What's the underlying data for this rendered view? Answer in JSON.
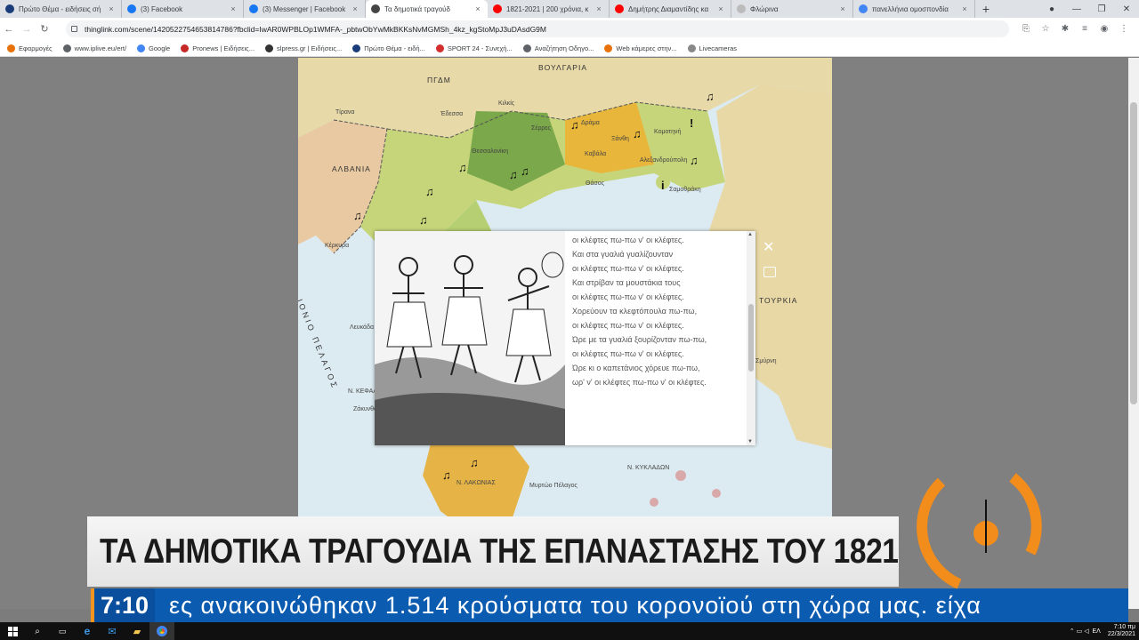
{
  "browser": {
    "tabs": [
      {
        "label": "Πρώτο Θέμα - ειδήσεις σή",
        "color": "#1a3c7a",
        "active": false
      },
      {
        "label": "(3) Facebook",
        "color": "#1877f2",
        "active": false
      },
      {
        "label": "(3) Messenger | Facebook",
        "color": "#1877f2",
        "active": false
      },
      {
        "label": "Τα δημοτικά τραγούδ",
        "color": "#444444",
        "active": true
      },
      {
        "label": "1821-2021 | 200 χρόνια, κ",
        "color": "#ff0000",
        "active": false
      },
      {
        "label": "Δημήτρης Διαμαντίδης κα",
        "color": "#ff0000",
        "active": false
      },
      {
        "label": "Φλώρινα",
        "color": "#bbbbbb",
        "active": false
      },
      {
        "label": "πανελλήνια ομοσπονδία",
        "color": "#4285f4",
        "active": false
      }
    ],
    "url": "thinglink.com/scene/1420522754653814786?fbclid=IwAR0WPBLOp1WMFA-_pbtwObYwMkBKKsNvMGMSh_4kz_kgStoMpJ3uDAsdG9M",
    "bookmarks": [
      {
        "label": "Εφαρμογές",
        "color": "#e8710a"
      },
      {
        "label": "www.iplive.eu/ert/",
        "color": "#5f6368"
      },
      {
        "label": "Google",
        "color": "#4285f4"
      },
      {
        "label": "Pronews | Ειδήσεις...",
        "color": "#c62828"
      },
      {
        "label": "slpress.gr | Ειδήσεις...",
        "color": "#333333"
      },
      {
        "label": "Πρώτο Θέμα - ειδή...",
        "color": "#1a3c7a"
      },
      {
        "label": "SPORT 24 - Συνεχή...",
        "color": "#d32f2f"
      },
      {
        "label": "Αναζήτηση Οδηγο...",
        "color": "#5f6368"
      },
      {
        "label": "Web κάμερες στην...",
        "color": "#e8710a"
      },
      {
        "label": "Livecameras",
        "color": "#888888"
      }
    ]
  },
  "map": {
    "labels": {
      "bulgaria": "ΒΟΥΛΓΑΡΙΑ",
      "pgdm": "ΠΓΔΜ",
      "albania": "ΑΛΒΑΝΙΑ",
      "turkey": "ΤΟΥΡΚΙΑ",
      "ionio": "ΙΟΝΙΟ ΠΕΛΑΓΟΣ",
      "tirana": "Τίρανα",
      "serres": "Σέρρες",
      "drama": "Δράμα",
      "kavala": "Καβάλα",
      "xanthi": "Ξάνθη",
      "komotini": "Κομοτηνή",
      "alexandroupoli": "Αλεξανδρούπολη",
      "thasos": "Θάσος",
      "samothraki": "Σαμοθράκη",
      "kerkyra": "Κέρκυρα",
      "lefkada": "Λευκάδα",
      "zakynthos": "Ζάκυνθος",
      "smyrni": "Σμύρνη",
      "myrtoo": "Μυρτώο Πέλαγος",
      "kyklades": "Ν. ΚΥΚΛΑΔΩΝ",
      "lakonia": "Ν. ΛΑΚΩΝΙΑΣ",
      "kefalonia": "Ν. ΚΕΦΑΛ",
      "thessaloniki": "Θεσσαλονίκη",
      "edessa": "Έδεσσα",
      "kilkis": "Κιλκίς"
    }
  },
  "popup": {
    "lines": [
      "οι κλέφτες πω-πω ν' οι κλέφτες.",
      "Και στα γυαλιά γυαλίζουνταν",
      "οι κλέφτες πω-πω ν' οι κλέφτες.",
      "Και στρίβαν τα μουστάκια τους",
      "οι κλέφτες πω-πω ν' οι κλέφτες.",
      "Χορεύουν τα κλεφτόπουλα πω-πω,",
      "οι κλέφτες πω-πω ν' οι κλέφτες.",
      "Ώρε με τα γυαλιά ξουρίζονταν πω-πω,",
      "οι κλέφτες πω-πω ν' οι κλέφτες.",
      "Ώρε κι ο καπετάνιος χόρευε πω-πω,",
      "ωρ' ν' οι κλέφτες πω-πω ν' οι κλέφτες."
    ],
    "close_icon": "close-icon",
    "audio_icon": "audio-icon"
  },
  "tv": {
    "headline": "ΤΑ ΔΗΜΟΤΙΚΑ ΤΡΑΓΟΥΔΙΑ ΤΗΣ ΕΠΑΝΑΣΤΑΣΗΣ ΤΟΥ 1821",
    "time": "7:10",
    "ticker": "ες  ανακοινώθηκαν  1.514  κρούσματα  του  κορονοϊού  στη  χώρα  μας.  είχα",
    "accent": "#f2941d",
    "ticker_bg": "#0b5bb0"
  },
  "taskbar": {
    "lang": "ΕΛ",
    "clock_time": "7:10 πμ",
    "clock_date": "22/3/2021"
  }
}
